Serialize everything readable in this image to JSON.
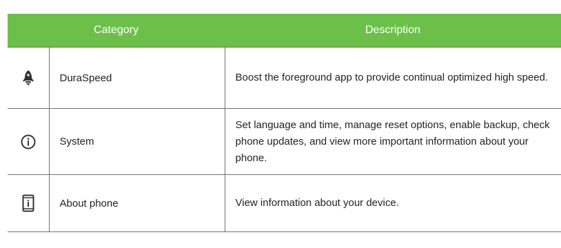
{
  "table": {
    "headers": {
      "category": "Category",
      "description": "Description"
    },
    "rows": [
      {
        "icon": "rocket-icon",
        "category": "DuraSpeed",
        "description": "Boost the foreground app to provide continual optimized high speed."
      },
      {
        "icon": "info-circle-icon",
        "category": "System",
        "description": "Set language and time, manage reset options, enable backup, check phone updates, and view more important information about your phone."
      },
      {
        "icon": "phone-info-icon",
        "category": "About phone",
        "description": "View information about your device."
      }
    ]
  },
  "colors": {
    "header_background": "#6cc04a",
    "header_text": "#ffffff",
    "border": "#6f6f6f"
  }
}
